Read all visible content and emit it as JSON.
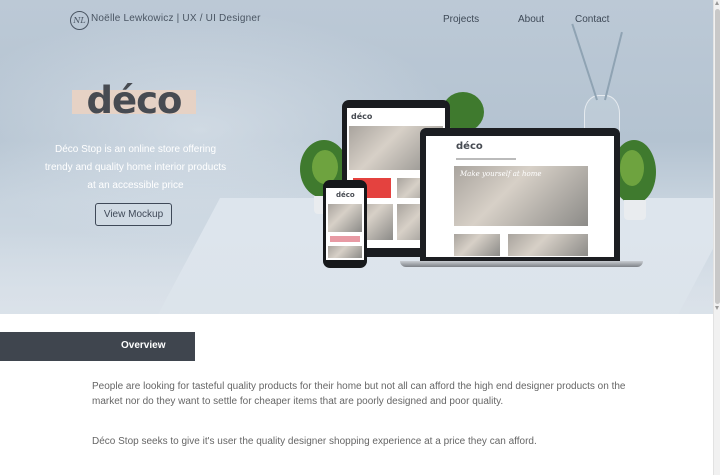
{
  "nav": {
    "logo_monogram": "NL",
    "brand": "Noëlle Lewkowicz | UX / UI Designer",
    "links": [
      "Projects",
      "About",
      "Contact"
    ]
  },
  "hero": {
    "logo_word": "déco",
    "tagline": "Déco Stop is an online store offering trendy and quality home interior products at an accessible price",
    "button": "View Mockup"
  },
  "mockups": {
    "screen_logo": "déco",
    "screen_headline": "Make yourself at home",
    "phone_logo": "déco"
  },
  "overview": {
    "title": "Overview",
    "paragraphs": [
      "People are looking for tasteful quality products for their home but not all can afford the high end designer products on the market nor do they want to settle for cheaper items that are poorly designed and poor quality.",
      "Déco Stop seeks to give it's user the quality designer shopping experience at a price they can afford."
    ]
  },
  "colors": {
    "hero_bg": "#b8c6d4",
    "accent_tag": "#e6d2c5",
    "dark": "#3f454e"
  }
}
